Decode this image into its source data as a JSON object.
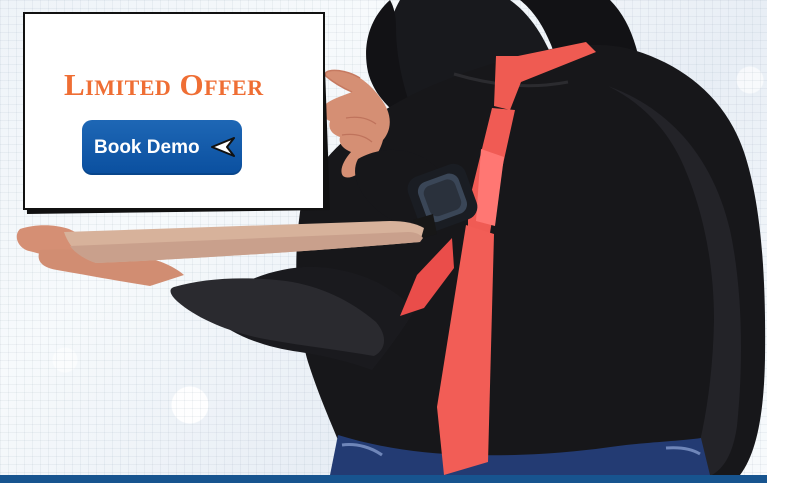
{
  "banner": {
    "headline": "Limited Offer",
    "cta_label": "Book Demo",
    "icon": "pointer-icon",
    "colors": {
      "headline": "#ef6e34",
      "button": "#0d58a8",
      "footer_strip": "#17548f"
    }
  }
}
